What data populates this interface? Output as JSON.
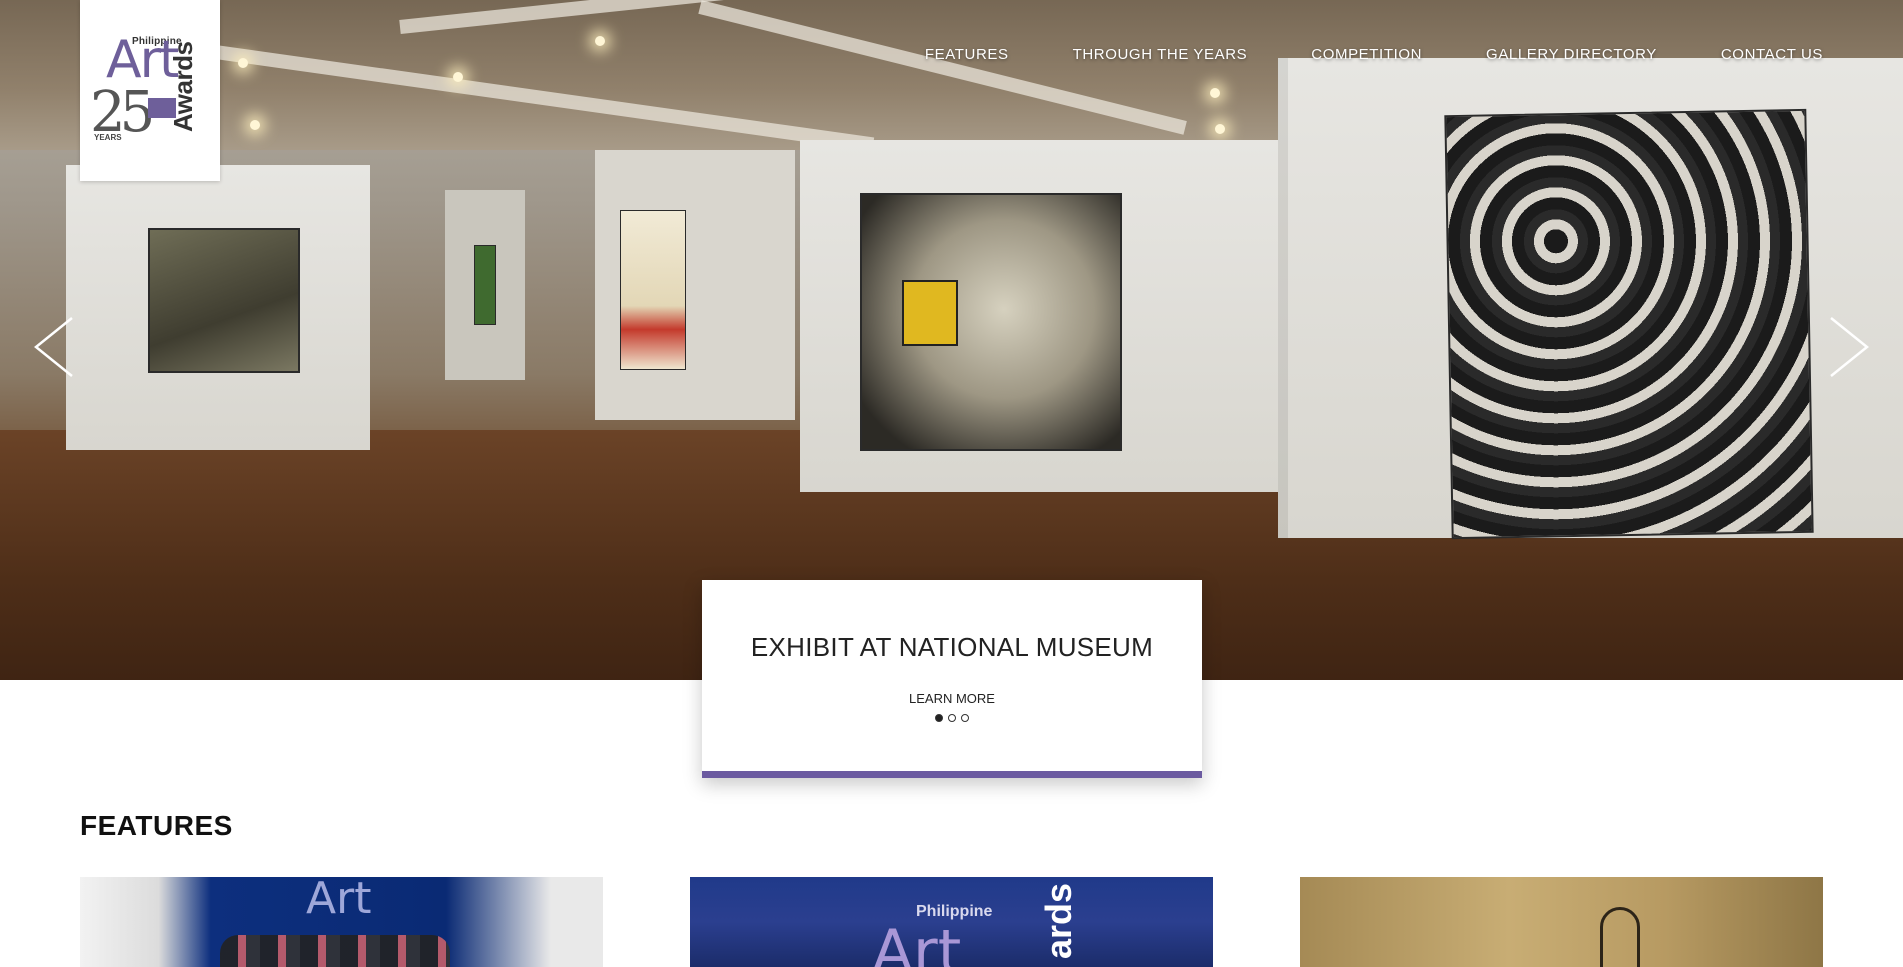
{
  "logo": {
    "top_text": "Philippine",
    "art_text": "Art",
    "number": "25",
    "years_text": "YEARS",
    "awards_text": "Awards"
  },
  "nav": {
    "items": [
      {
        "label": "FEATURES"
      },
      {
        "label": "THROUGH THE YEARS"
      },
      {
        "label": "COMPETITION"
      },
      {
        "label": "GALLERY DIRECTORY"
      },
      {
        "label": "CONTACT US"
      }
    ]
  },
  "hero": {
    "prev_icon": "chevron-left-icon",
    "next_icon": "chevron-right-icon",
    "slide_count": 3,
    "active_slide": 1
  },
  "caption": {
    "title": "EXHIBIT AT NATIONAL MUSEUM",
    "link": "LEARN MORE"
  },
  "features": {
    "heading": "FEATURES",
    "cards": [
      {
        "image_text": "Art"
      },
      {
        "image_text_small": "Philippine",
        "image_text_big": "Art",
        "image_text_vertical": "ards"
      },
      {}
    ]
  },
  "colors": {
    "accent": "#6b5aa0",
    "logo_purple": "#6e5f9a",
    "nav_text": "#ffffff"
  }
}
